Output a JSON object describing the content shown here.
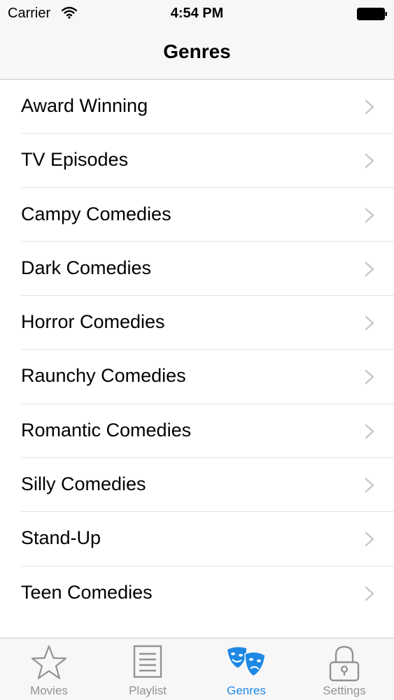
{
  "status_bar": {
    "carrier": "Carrier",
    "time": "4:54 PM",
    "wifi_icon": "wifi-icon",
    "battery_icon": "battery-icon"
  },
  "nav": {
    "title": "Genres"
  },
  "genres": {
    "items": [
      {
        "label": "Award Winning"
      },
      {
        "label": "TV Episodes"
      },
      {
        "label": "Campy Comedies"
      },
      {
        "label": "Dark Comedies"
      },
      {
        "label": "Horror Comedies"
      },
      {
        "label": "Raunchy Comedies"
      },
      {
        "label": "Romantic Comedies"
      },
      {
        "label": "Silly Comedies"
      },
      {
        "label": "Stand-Up"
      },
      {
        "label": "Teen Comedies"
      }
    ],
    "disclosure_icon": "chevron-right-icon"
  },
  "tab_bar": {
    "selected": "Genres",
    "tabs": [
      {
        "label": "Movies",
        "icon": "star-icon"
      },
      {
        "label": "Playlist",
        "icon": "list-icon"
      },
      {
        "label": "Genres",
        "icon": "theater-masks-icon"
      },
      {
        "label": "Settings",
        "icon": "lock-icon"
      }
    ]
  },
  "colors": {
    "accent": "#1e88e5",
    "inactive": "#929292",
    "bar_background": "#f7f7f7",
    "separator": "#c8c7cc"
  }
}
